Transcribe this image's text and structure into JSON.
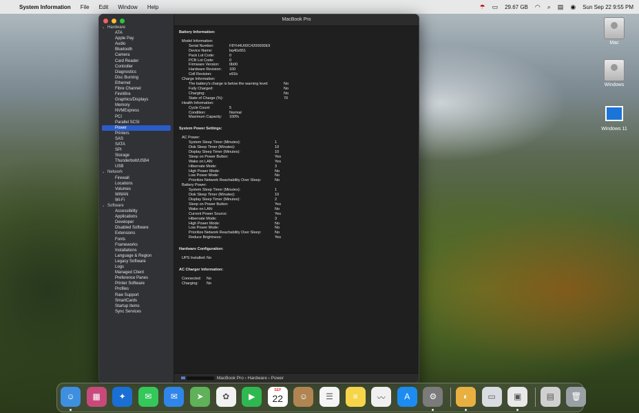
{
  "menubar": {
    "app_name": "System Information",
    "menus": [
      "File",
      "Edit",
      "Window",
      "Help"
    ],
    "storage": "29.67 GB",
    "clock": "Sun Sep 22  9:55 PM"
  },
  "desktop": {
    "icons": [
      {
        "label": "Mac",
        "icon": "disk-icon"
      },
      {
        "label": "Windows",
        "icon": "disk-icon"
      },
      {
        "label": "Windows 11",
        "icon": "windows-icon"
      }
    ]
  },
  "window": {
    "title": "MacBook Pro",
    "sidebar": {
      "groups": [
        {
          "label": "Hardware",
          "items": [
            "ATA",
            "Apple Pay",
            "Audio",
            "Bluetooth",
            "Camera",
            "Card Reader",
            "Controller",
            "Diagnostics",
            "Disc Burning",
            "Ethernet",
            "Fibre Channel",
            "FireWire",
            "Graphics/Displays",
            "Memory",
            "NVMExpress",
            "PCI",
            "Parallel SCSI",
            "Power",
            "Printers",
            "SAS",
            "SATA",
            "SPI",
            "Storage",
            "Thunderbolt/USB4",
            "USB"
          ]
        },
        {
          "label": "Network",
          "items": [
            "Firewall",
            "Locations",
            "Volumes",
            "WWAN",
            "Wi-Fi"
          ]
        },
        {
          "label": "Software",
          "items": [
            "Accessibility",
            "Applications",
            "Developer",
            "Disabled Software",
            "Extensions",
            "Fonts",
            "Frameworks",
            "Installations",
            "Language & Region",
            "Legacy Software",
            "Logs",
            "Managed Client",
            "Preference Panes",
            "Printer Software",
            "Profiles",
            "Raw Support",
            "SmartCards",
            "Startup Items",
            "Sync Services"
          ]
        }
      ],
      "selected": "Power"
    },
    "content": {
      "sections": [
        {
          "title": "Battery Information:",
          "rows": [
            {
              "k": "Model Information:",
              "v": "",
              "level": 1
            },
            {
              "k": "Serial Number:",
              "v": "F8YH4U00C4200000E9",
              "level": 2
            },
            {
              "k": "Device Name:",
              "v": "bq40z651",
              "level": 2
            },
            {
              "k": "Pack Lot Code:",
              "v": "0",
              "level": 2
            },
            {
              "k": "PCB Lot Code:",
              "v": "0",
              "level": 2
            },
            {
              "k": "Firmware Version:",
              "v": "0b00",
              "level": 2
            },
            {
              "k": "Hardware Revision:",
              "v": "100",
              "level": 2
            },
            {
              "k": "Cell Revision:",
              "v": "e91b",
              "level": 2
            },
            {
              "k": "Charge Information:",
              "v": "",
              "level": 1
            },
            {
              "k": "The battery's charge is below the warning level:",
              "v": "No",
              "level": 2
            },
            {
              "k": "Fully Charged:",
              "v": "No",
              "level": 2
            },
            {
              "k": "Charging:",
              "v": "No",
              "level": 2
            },
            {
              "k": "State of Charge (%):",
              "v": "70",
              "level": 2
            },
            {
              "k": "Health Information:",
              "v": "",
              "level": 1
            },
            {
              "k": "Cycle Count:",
              "v": "5",
              "level": 2
            },
            {
              "k": "Condition:",
              "v": "Normal",
              "level": 2
            },
            {
              "k": "Maximum Capacity:",
              "v": "100%",
              "level": 2
            }
          ]
        },
        {
          "title": "System Power Settings:",
          "rows": [
            {
              "k": "AC Power:",
              "v": "",
              "level": 1
            },
            {
              "k": "System Sleep Timer (Minutes):",
              "v": "1",
              "level": 2
            },
            {
              "k": "Disk Sleep Timer (Minutes):",
              "v": "10",
              "level": 2
            },
            {
              "k": "Display Sleep Timer (Minutes):",
              "v": "10",
              "level": 2
            },
            {
              "k": "Sleep on Power Button:",
              "v": "Yes",
              "level": 2
            },
            {
              "k": "Wake on LAN:",
              "v": "Yes",
              "level": 2
            },
            {
              "k": "Hibernate Mode:",
              "v": "3",
              "level": 2
            },
            {
              "k": "High Power Mode:",
              "v": "No",
              "level": 2
            },
            {
              "k": "Low Power Mode:",
              "v": "No",
              "level": 2
            },
            {
              "k": "Prioritize Network Reachability Over Sleep:",
              "v": "No",
              "level": 2
            },
            {
              "k": "Battery Power:",
              "v": "",
              "level": 1
            },
            {
              "k": "System Sleep Timer (Minutes):",
              "v": "1",
              "level": 2
            },
            {
              "k": "Disk Sleep Timer (Minutes):",
              "v": "10",
              "level": 2
            },
            {
              "k": "Display Sleep Timer (Minutes):",
              "v": "2",
              "level": 2
            },
            {
              "k": "Sleep on Power Button:",
              "v": "Yes",
              "level": 2
            },
            {
              "k": "Wake on LAN:",
              "v": "No",
              "level": 2
            },
            {
              "k": "Current Power Source:",
              "v": "Yes",
              "level": 2
            },
            {
              "k": "Hibernate Mode:",
              "v": "3",
              "level": 2
            },
            {
              "k": "High Power Mode:",
              "v": "No",
              "level": 2
            },
            {
              "k": "Low Power Mode:",
              "v": "No",
              "level": 2
            },
            {
              "k": "Prioritize Network Reachability Over Sleep:",
              "v": "No",
              "level": 2
            },
            {
              "k": "Reduce Brightness:",
              "v": "Yes",
              "level": 2
            }
          ]
        },
        {
          "title": "Hardware Configuration:",
          "rows": [
            {
              "k": "UPS Installed:",
              "v": "No",
              "level": 1
            }
          ]
        },
        {
          "title": "AC Charger Information:",
          "rows": [
            {
              "k": "Connected:",
              "v": "No",
              "level": 1
            },
            {
              "k": "Charging:",
              "v": "No",
              "level": 1
            }
          ]
        }
      ]
    },
    "pathbar": {
      "items": [
        "MacBook Pro",
        "Hardware",
        "Power"
      ],
      "separator": "›"
    }
  },
  "dock": {
    "apps": [
      {
        "name": "finder-icon",
        "color": "#3f8fe0"
      },
      {
        "name": "launchpad-icon",
        "color": "#c94a7a"
      },
      {
        "name": "safari-icon",
        "color": "#1a6fd4"
      },
      {
        "name": "messages-icon",
        "color": "#34c759"
      },
      {
        "name": "mail-icon",
        "color": "#2f86e8"
      },
      {
        "name": "maps-icon",
        "color": "#5fb15a"
      },
      {
        "name": "photos-icon",
        "color": "#f2f2f2"
      },
      {
        "name": "facetime-icon",
        "color": "#2fb84f"
      },
      {
        "name": "calendar-icon",
        "color": "#ffffff"
      },
      {
        "name": "contacts-icon",
        "color": "#b08552"
      },
      {
        "name": "reminders-icon",
        "color": "#f5f5f5"
      },
      {
        "name": "notes-icon",
        "color": "#f6d54a"
      },
      {
        "name": "freeform-icon",
        "color": "#f0f0f0"
      },
      {
        "name": "app-store-icon",
        "color": "#1c8cf0"
      },
      {
        "name": "system-settings-icon",
        "color": "#7b7b7b"
      },
      {
        "name": "disk-utility-icon",
        "color": "#e8b040"
      },
      {
        "name": "boot-camp-icon",
        "color": "#d8dbe0"
      },
      {
        "name": "system-information-icon",
        "color": "#e9e9e9"
      },
      {
        "name": "printer-icon",
        "color": "#d0d0d0"
      },
      {
        "name": "trash-icon",
        "color": "#9aa0a6"
      }
    ],
    "calendar": {
      "month": "SEP",
      "day": "22"
    }
  }
}
